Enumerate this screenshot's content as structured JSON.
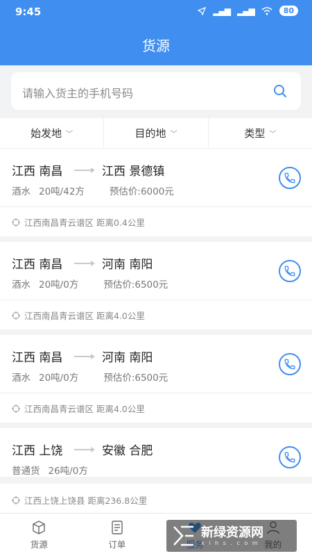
{
  "status_bar": {
    "time": "9:45",
    "battery": "80"
  },
  "header": {
    "title": "货源"
  },
  "search": {
    "placeholder": "请输入货主的手机号码"
  },
  "filters": [
    {
      "label": "始发地"
    },
    {
      "label": "目的地"
    },
    {
      "label": "类型"
    }
  ],
  "listings": [
    {
      "from": "江西 南昌",
      "to": "江西 景德镇",
      "goods": "酒水",
      "load": "20吨/42方",
      "price": "预估价:6000元",
      "location": "江西南昌青云谱区 距离0.4公里"
    },
    {
      "from": "江西 南昌",
      "to": "河南 南阳",
      "goods": "酒水",
      "load": "20吨/0方",
      "price": "预估价:6500元",
      "location": "江西南昌青云谱区 距离4.0公里"
    },
    {
      "from": "江西 南昌",
      "to": "河南 南阳",
      "goods": "酒水",
      "load": "20吨/0方",
      "price": "预估价:6500元",
      "location": "江西南昌青云谱区 距离4.0公里"
    },
    {
      "from": "江西 上饶",
      "to": "安徽 合肥",
      "goods": "普通货",
      "load": "26吨/0方",
      "price": "",
      "location": "江西上饶上饶县 距离236.8公里"
    }
  ],
  "tabs": [
    {
      "label": "货源",
      "icon": "cube-icon"
    },
    {
      "label": "订单",
      "icon": "document-icon"
    },
    {
      "label": "服务",
      "icon": "heart-icon"
    },
    {
      "label": "我的",
      "icon": "person-icon"
    }
  ],
  "watermark": {
    "text": "新绿资源网",
    "sub": "x i h s . c o m"
  },
  "colors": {
    "primary": "#3f8ef0",
    "background": "#f2f3f5"
  }
}
